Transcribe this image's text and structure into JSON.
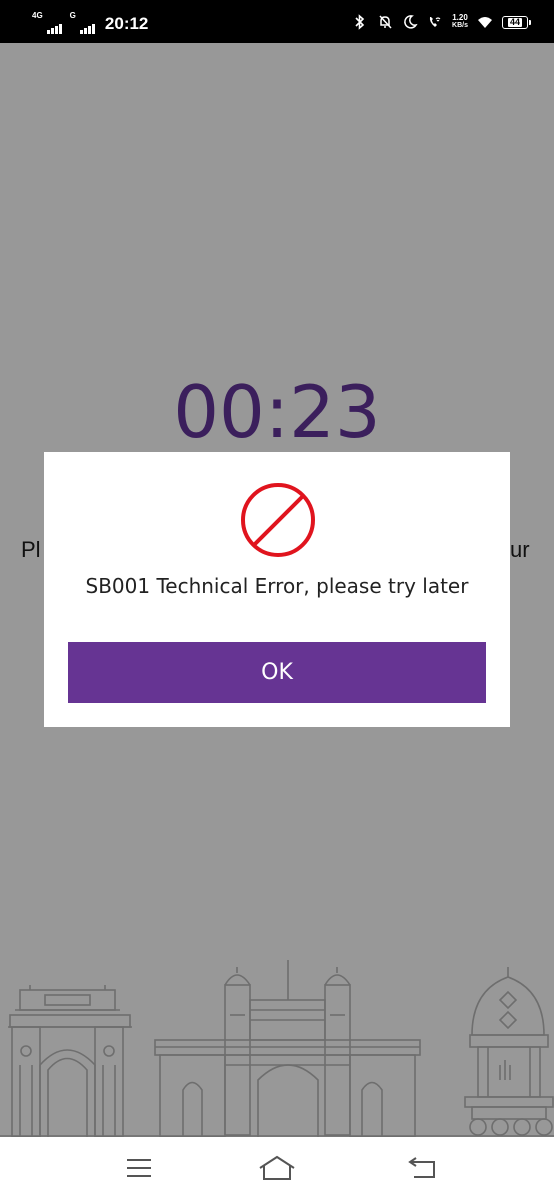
{
  "status_bar": {
    "network1": "4G",
    "network2": "G",
    "time": "20:12",
    "speed_value": "1.20",
    "speed_unit": "KB/s",
    "battery": "44"
  },
  "background": {
    "timer": "00:23",
    "text_left_fragment": "Pl",
    "text_right_fragment": "ur"
  },
  "dialog": {
    "icon": "prohibited-icon",
    "message": "SB001 Technical Error, please try later",
    "ok_label": "OK",
    "accent_color": "#663493",
    "icon_color": "#e0141e"
  },
  "nav_bar": {
    "items": [
      "menu-icon",
      "home-icon",
      "back-icon"
    ]
  }
}
